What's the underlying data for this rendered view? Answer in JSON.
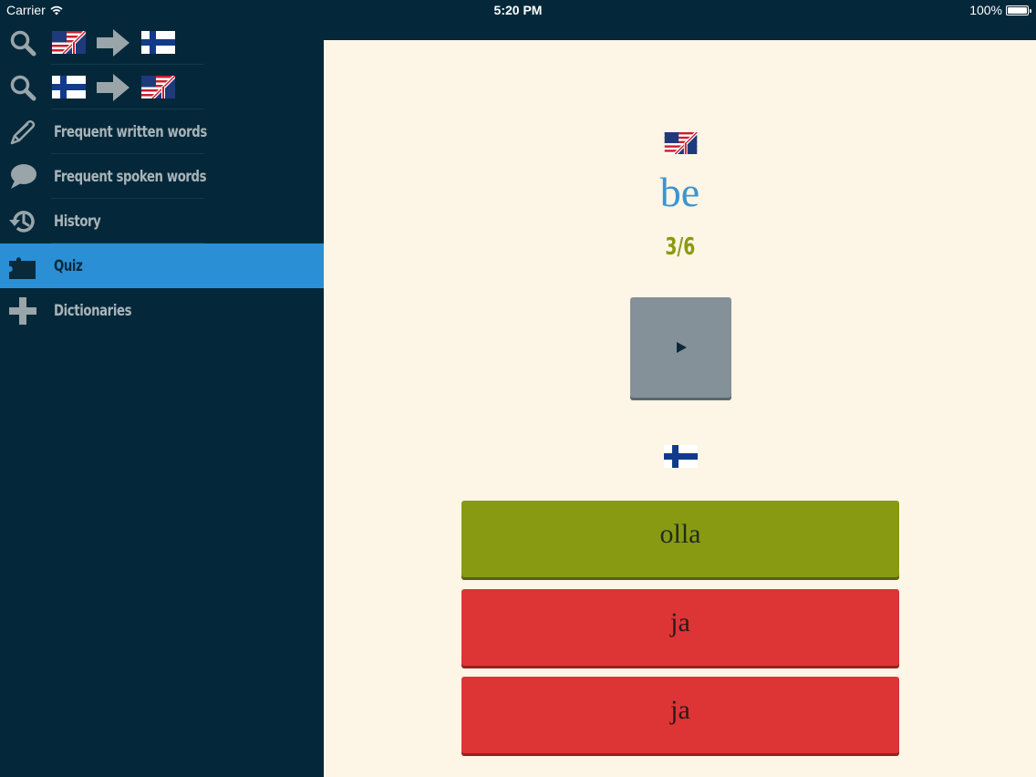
{
  "status_bar": {
    "carrier": "Carrier",
    "time": "5:20 PM",
    "battery": "100%"
  },
  "sidebar": {
    "items": [
      {
        "name": "search-en-fi",
        "icons": [
          "search-icon",
          "uk-us-flag-icon",
          "arrow-right-icon",
          "finland-flag-icon"
        ]
      },
      {
        "name": "search-fi-en",
        "icons": [
          "search-icon",
          "finland-flag-icon",
          "arrow-right-icon",
          "uk-us-flag-icon"
        ]
      },
      {
        "label": "Frequent written words",
        "icon": "pen-icon"
      },
      {
        "label": "Frequent spoken words",
        "icon": "speech-bubble-icon"
      },
      {
        "label": "History",
        "icon": "history-icon"
      },
      {
        "label": "Quiz",
        "icon": "puzzle-icon",
        "active": true
      },
      {
        "label": "Dictionaries",
        "icon": "plus-icon"
      }
    ]
  },
  "quiz": {
    "word": "be",
    "progress": "3/6",
    "answers": [
      {
        "text": "olla",
        "state": "correct"
      },
      {
        "text": "ja",
        "state": "wrong"
      },
      {
        "text": "ja",
        "state": "wrong"
      }
    ]
  },
  "colors": {
    "sidebar_bg": "#04283a",
    "active_item": "#2b8fd6",
    "main_bg": "#fdf5e6",
    "word": "#3a95d1",
    "progress": "#8a9a10",
    "correct": "#889a12",
    "wrong": "#dd3436",
    "play_button": "#859198"
  }
}
